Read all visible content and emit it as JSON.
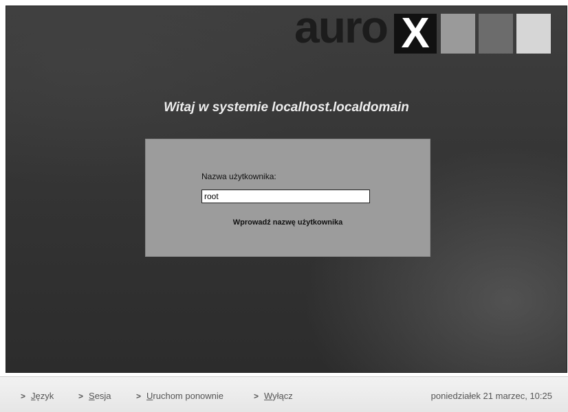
{
  "logo": {
    "word": "auro",
    "x_letter": "X"
  },
  "welcome": {
    "title": "Witaj w systemie localhost.localdomain"
  },
  "login": {
    "username_label": "Nazwa użytkownika:",
    "username_value": "root",
    "prompt": "Wprowadź nazwę użytkownika"
  },
  "bottom_menu": {
    "items": [
      {
        "label": "Język",
        "mnemonic": "J"
      },
      {
        "label": "Sesja",
        "mnemonic": "S"
      },
      {
        "label": "Uruchom ponownie",
        "mnemonic": "U"
      },
      {
        "label": "Wyłącz",
        "mnemonic": "W"
      }
    ],
    "clock": "poniedziałek 21 marzec, 10:25"
  },
  "colors": {
    "background": "#333333",
    "panel": "#9c9c9c",
    "bar": "#ececec"
  },
  "icons": {
    "menu_item": "chevron-right-icon"
  }
}
